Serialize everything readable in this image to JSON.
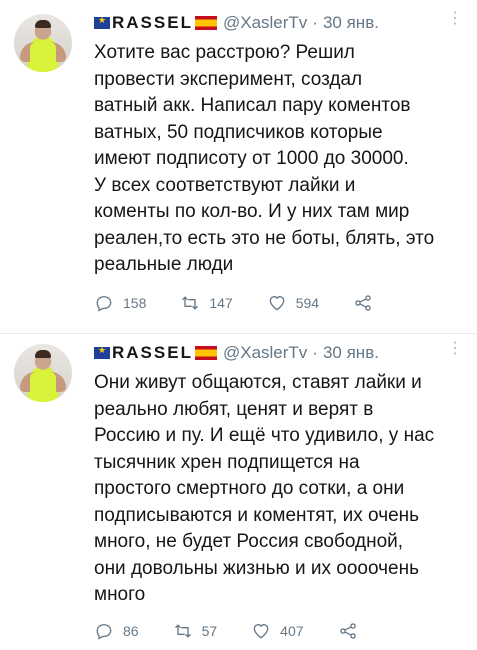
{
  "tweets": [
    {
      "author": {
        "name": "RASSEL",
        "handle": "@XaslerTv"
      },
      "separator": "·",
      "date": "30 янв.",
      "more_icon": "⋮",
      "text": "Хотите вас расстрою? Решил\nпровести эксперимент, создал\nватный акк. Написал пару ко­ментов\nватных, 50 подписчиков которые\nимеют подписоту от 1000 до 30000.\nУ всех соответствуют лайки и\nкоменты по кол-во. И у них там мир\nреален,то есть это не боты, блять, это\nреальные люди",
      "replies": "158",
      "retweets": "147",
      "likes": "594"
    },
    {
      "author": {
        "name": "RASSEL",
        "handle": "@XaslerTv"
      },
      "separator": "·",
      "date": "30 янв.",
      "more_icon": "⋮",
      "text": "Они живут общаются, ставят лайки и\nреально любят, ценят и верят в\nРоссию и пу. И ещё что удивило, у нас\nтысячник хрен подпищется на\nпростого смертного до сотки, а они\nподписываются и комен­тят, их очень\nмного, не будет Россия свободной,\nони довольны жизнью и их оооочень\nмного",
      "replies": "86",
      "retweets": "57",
      "likes": "407"
    }
  ]
}
